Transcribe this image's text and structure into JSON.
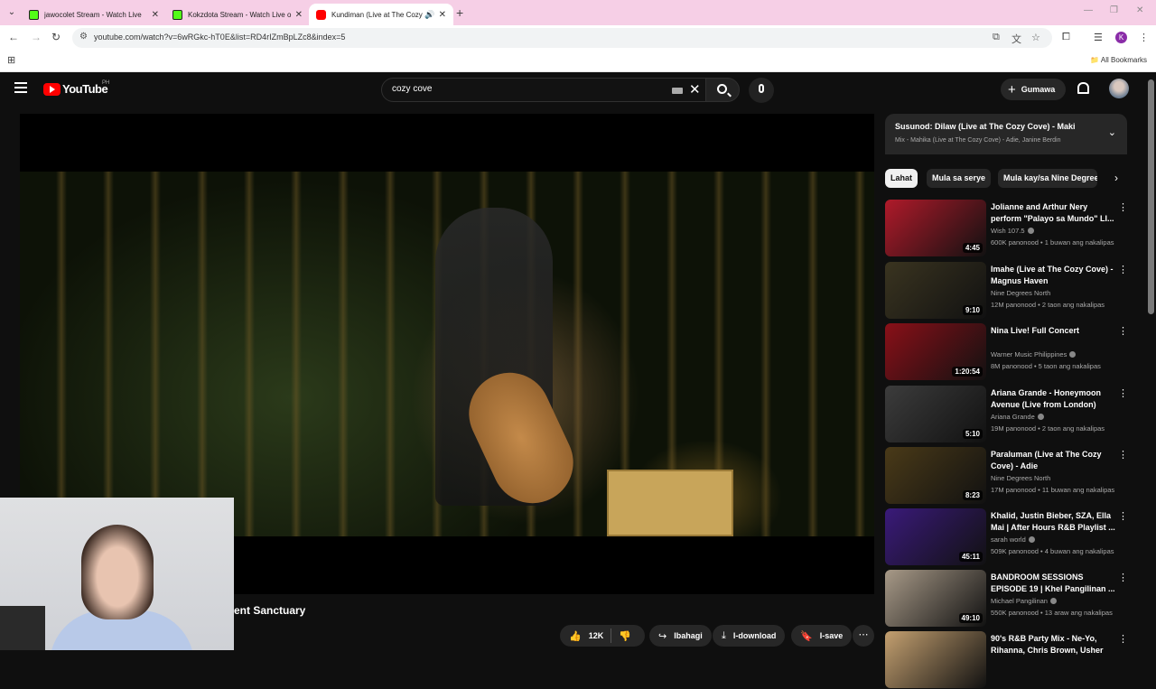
{
  "browser": {
    "tabs": [
      {
        "title": "jawocolet Stream - Watch Live",
        "favicon": "kick-icon"
      },
      {
        "title": "Kokzdota Stream - Watch Live o",
        "favicon": "kick-icon"
      },
      {
        "title": "Kundiman (Live at The Cozy Cove)",
        "favicon": "youtube-icon"
      }
    ],
    "url": "youtube.com/watch?v=6wRGkc-hT0E&list=RD4rIZmBpLZc8&index=5",
    "profile_initial": "K",
    "all_bookmarks": "All Bookmarks"
  },
  "youtube": {
    "logo_text": "YouTube",
    "country": "PH",
    "search_value": "cozy cove",
    "create_label": "Gumawa"
  },
  "video": {
    "title_visible": "ent Sanctuary",
    "likes": "12K",
    "share_label": "Ibahagi",
    "download_label": "I-download",
    "save_label": "I-save"
  },
  "up_next": {
    "title": "Susunod: Dilaw (Live at The Cozy Cove) - Maki",
    "subtitle": "Mix - Mahika (Live at The Cozy Cove) - Adie, Janine Berdin"
  },
  "chips": [
    "Lahat",
    "Mula sa serye",
    "Mula kay/sa Nine Degrees North"
  ],
  "recommendations": [
    {
      "title": "Jolianne and Arthur Nery perform \"Palayo sa Mundo\" LI...",
      "channel": "Wish 107.5",
      "verified": true,
      "meta": "600K panonood • 1 buwan ang nakalipas",
      "duration": "4:45",
      "color": "#b01a2a"
    },
    {
      "title": "Imahe (Live at The Cozy Cove) - Magnus Haven",
      "channel": "Nine Degrees North",
      "verified": false,
      "meta": "12M panonood • 2 taon ang nakalipas",
      "duration": "9:10",
      "color": "#3a3420"
    },
    {
      "title": "Nina Live! Full Concert",
      "channel": "Warner Music Philippines",
      "verified": true,
      "meta": "8M panonood • 5 taon ang nakalipas",
      "duration": "1:20:54",
      "color": "#8a1018"
    },
    {
      "title": "Ariana Grande - Honeymoon Avenue (Live from London)",
      "channel": "Ariana Grande",
      "verified": true,
      "meta": "19M panonood • 2 taon ang nakalipas",
      "duration": "5:10",
      "color": "#3c3c3c"
    },
    {
      "title": "Paraluman (Live at The Cozy Cove) - Adie",
      "channel": "Nine Degrees North",
      "verified": false,
      "meta": "17M panonood • 11 buwan ang nakalipas",
      "duration": "8:23",
      "color": "#4a3a18"
    },
    {
      "title": "Khalid, Justin Bieber, SZA, Ella Mai | After Hours R&B Playlist ...",
      "channel": "sarah world",
      "verified": true,
      "meta": "509K panonood • 4 buwan ang nakalipas",
      "duration": "45:11",
      "color": "#3a1a7a"
    },
    {
      "title": "BANDROOM SESSIONS EPISODE 19 | Khel Pangilinan ...",
      "channel": "Michael Pangilinan",
      "verified": true,
      "meta": "550K panonood • 13 araw ang nakalipas",
      "duration": "49:10",
      "color": "#a89a88"
    },
    {
      "title": "90's R&B Party Mix - Ne-Yo, Rihanna, Chris Brown, Usher",
      "channel": "",
      "verified": false,
      "meta": "",
      "duration": "",
      "color": "#c4a070"
    }
  ]
}
